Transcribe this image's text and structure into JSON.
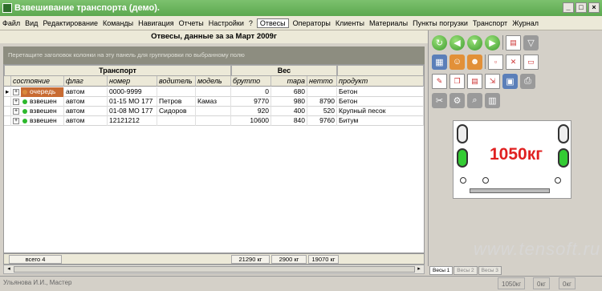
{
  "window": {
    "title": "Взвешивание транспорта (демо)."
  },
  "menu": [
    "Файл",
    "Вид",
    "Редактирование",
    "Команды",
    "Навигация",
    "Отчеты",
    "Настройки",
    "?"
  ],
  "tabs": {
    "active": "Отвесы",
    "items": [
      "Операторы",
      "Клиенты",
      "Материалы",
      "Пункты погрузки",
      "Транспорт",
      "Журнал"
    ]
  },
  "heading": "Отвесы, данные за  за Март 2009г",
  "group_hint": "Перетащите заголовок колонки на эту панель для группировки по выбранному полю",
  "bands": {
    "transport": "Транспорт",
    "weight": "Вес"
  },
  "columns": [
    "состояние",
    "флаг",
    "номер",
    "водитель",
    "модель",
    "брутто",
    "тара",
    "нетто",
    "продукт"
  ],
  "rows": [
    {
      "state": "очередь",
      "flag": "автом",
      "number": "0000-9999",
      "driver": "",
      "model": "",
      "gross": "0",
      "tare": "680",
      "net": "",
      "product": "Бетон",
      "status_color": "#d98a3c"
    },
    {
      "state": "взвешен",
      "flag": "автом",
      "number": "01-15 МО 177",
      "driver": "Петров",
      "model": "Камаз",
      "gross": "9770",
      "tare": "980",
      "net": "8790",
      "product": "Бетон",
      "status_color": "#2cb82c"
    },
    {
      "state": "взвешен",
      "flag": "автом",
      "number": "01-08 МО 177",
      "driver": "Сидоров",
      "model": "",
      "gross": "920",
      "tare": "400",
      "net": "520",
      "product": "Крупный песок",
      "status_color": "#2cb82c"
    },
    {
      "state": "взвешен",
      "flag": "автом",
      "number": "12121212",
      "driver": "",
      "model": "",
      "gross": "10600",
      "tare": "840",
      "net": "9760",
      "product": "Битум",
      "status_color": "#2cb82c"
    }
  ],
  "footer": {
    "total": "всего 4",
    "gross": "21290 кг",
    "tare": "2900 кг",
    "net": "19070 кг"
  },
  "scale": {
    "reading": "1050кг"
  },
  "scale_tabs": [
    "Весы 1",
    "Весы 2",
    "Весы 3"
  ],
  "status": {
    "user": "Ульянова И.И., Мастер",
    "w1": "1050кг",
    "w2": "0кг",
    "w3": "0кг"
  },
  "watermark": "www.tensoft.ru",
  "colors": {
    "titlebar": "#6cb85f",
    "scale_text": "#e02020",
    "wheel_green": "#33cc33"
  }
}
